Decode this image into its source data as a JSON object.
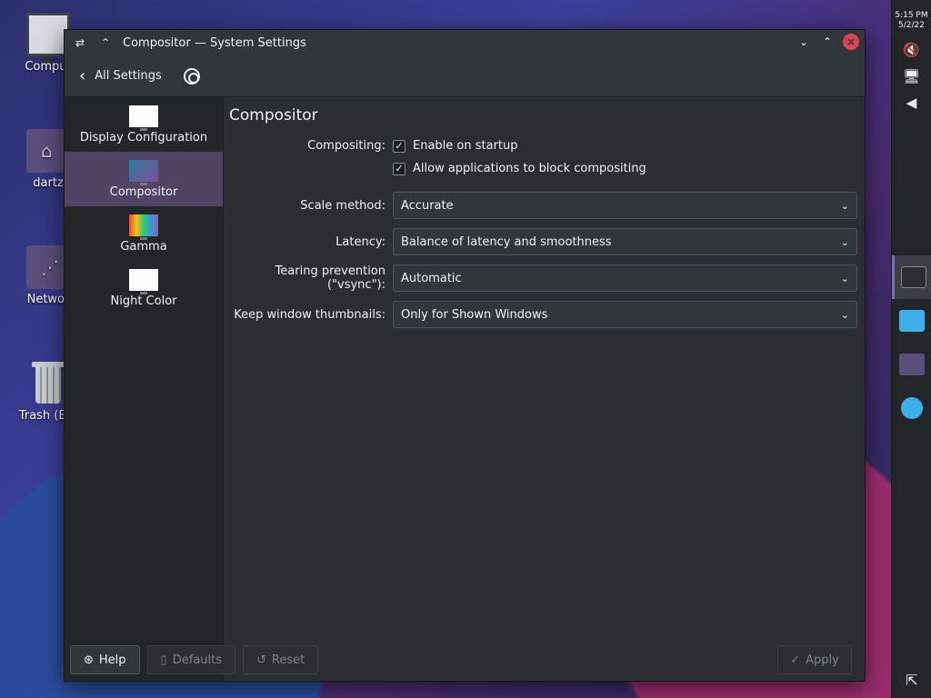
{
  "desktop": {
    "icons": [
      {
        "label": "Comput",
        "icon": "computer-icon"
      },
      {
        "label": "dartz",
        "icon": "home-folder-icon"
      },
      {
        "label": "Networ",
        "icon": "network-folder-icon"
      },
      {
        "label": "Trash (Em",
        "icon": "trash-icon"
      }
    ]
  },
  "panel": {
    "time": "5:15 PM",
    "date": "5/2/22"
  },
  "window": {
    "title": "Compositor — System Settings",
    "toolbar": {
      "back_label": "All Settings"
    },
    "sidebar": {
      "items": [
        {
          "label": "Display Configuration"
        },
        {
          "label": "Compositor"
        },
        {
          "label": "Gamma"
        },
        {
          "label": "Night Color"
        }
      ]
    },
    "content": {
      "title": "Compositor",
      "compositing_label": "Compositing:",
      "enable_on_startup": "Enable on startup",
      "allow_block": "Allow applications to block compositing",
      "scale_method_label": "Scale method:",
      "scale_method_value": "Accurate",
      "latency_label": "Latency:",
      "latency_value": "Balance of latency and smoothness",
      "tearing_label": "Tearing prevention (\"vsync\"):",
      "tearing_value": "Automatic",
      "thumbnails_label": "Keep window thumbnails:",
      "thumbnails_value": "Only for Shown Windows"
    },
    "footer": {
      "help": "Help",
      "defaults": "Defaults",
      "reset": "Reset",
      "apply": "Apply"
    }
  }
}
